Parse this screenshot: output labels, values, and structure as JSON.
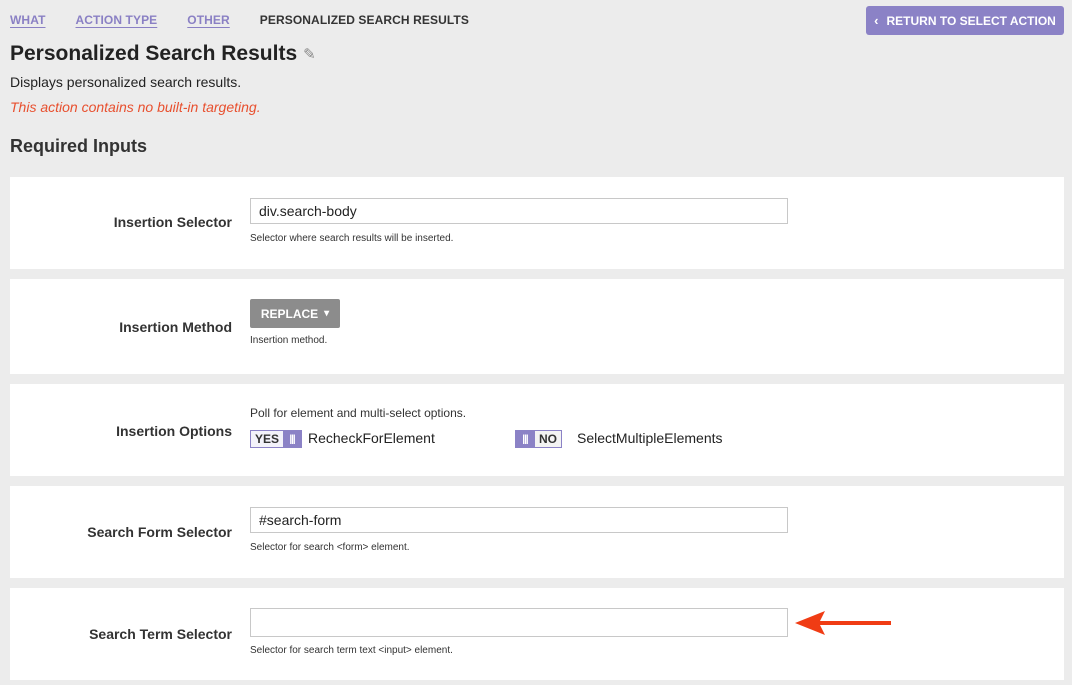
{
  "breadcrumb": {
    "items": [
      "WHAT",
      "ACTION TYPE",
      "OTHER",
      "PERSONALIZED SEARCH RESULTS"
    ]
  },
  "return_button": {
    "label": "RETURN TO SELECT ACTION",
    "icon": "chevron-left-icon"
  },
  "page": {
    "title": "Personalized Search Results",
    "edit_icon": "pencil-icon",
    "description": "Displays personalized search results.",
    "warning": "This action contains no built-in targeting."
  },
  "section": {
    "heading": "Required Inputs"
  },
  "fields": {
    "insertion_selector": {
      "label": "Insertion Selector",
      "value": "div.search-body",
      "help": "Selector where search results will be inserted."
    },
    "insertion_method": {
      "label": "Insertion Method",
      "selected": "REPLACE",
      "help": "Insertion method."
    },
    "insertion_options": {
      "label": "Insertion Options",
      "help": "Poll for element and multi-select options.",
      "recheck": {
        "state": "YES",
        "name": "RecheckForElement"
      },
      "select_multiple": {
        "state": "NO",
        "name": "SelectMultipleElements"
      }
    },
    "search_form_selector": {
      "label": "Search Form Selector",
      "value": "#search-form",
      "help": "Selector for search <form> element."
    },
    "search_term_selector": {
      "label": "Search Term Selector",
      "value": "",
      "help": "Selector for search term text <input> element."
    }
  },
  "colors": {
    "accent": "#8b82c6",
    "warning": "#e8502f",
    "annotation_arrow": "#f03c14",
    "dropdown": "#8c8c8c",
    "background": "#ececec"
  }
}
